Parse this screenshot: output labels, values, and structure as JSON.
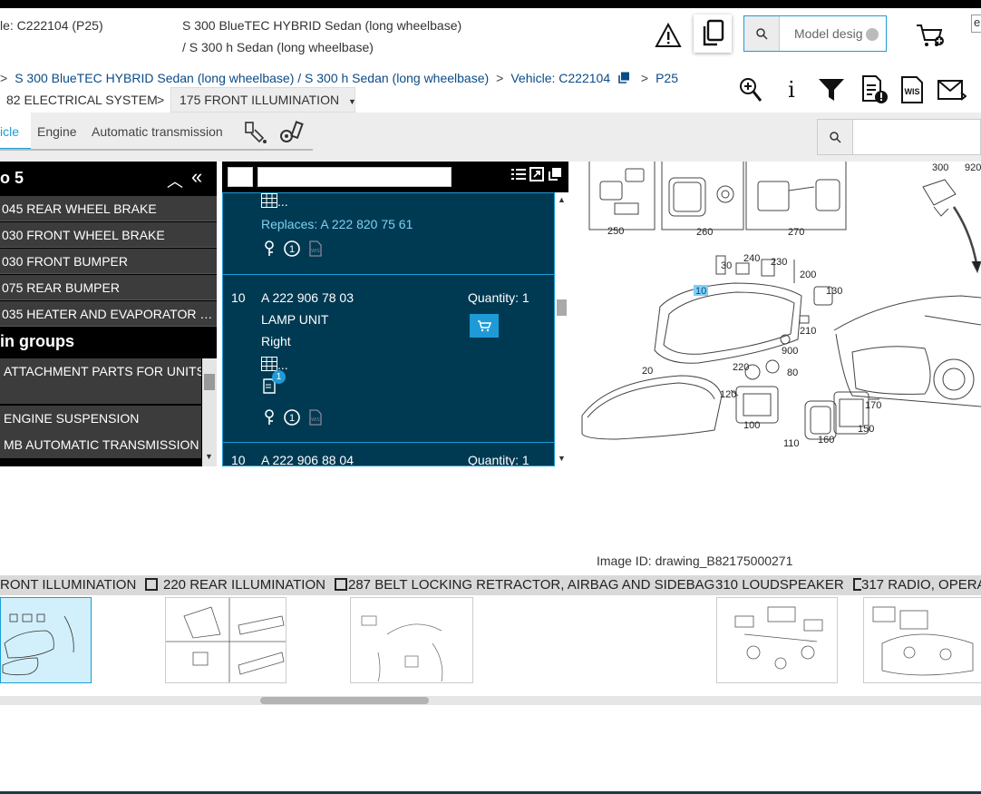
{
  "header": {
    "vehicle_prefix": "le: C222104 (P25)",
    "model_line1": "S 300 BlueTEC HYBRID Sedan (long wheelbase)",
    "model_line2": "/ S 300 h Sedan (long wheelbase)",
    "search_placeholder": "Model desig",
    "partial_right": "e"
  },
  "breadcrumb": {
    "item1": "S 300 BlueTEC HYBRID Sedan (long wheelbase) / S 300 h Sedan (long wheelbase)",
    "item2": "Vehicle: C222104",
    "item3": "P25",
    "group": "82 ELECTRICAL SYSTEM",
    "subgroup": "175 FRONT ILLUMINATION"
  },
  "tabs": [
    {
      "label": "icle"
    },
    {
      "label": "Engine"
    },
    {
      "label": "Automatic transmission"
    }
  ],
  "left_panel": {
    "title": "o 5",
    "recent": [
      "045 REAR WHEEL BRAKE",
      "030 FRONT WHEEL BRAKE",
      "030 FRONT BUMPER",
      "075 REAR BUMPER",
      "035 HEATER AND EVAPORATOR H..."
    ],
    "groups_title": "in groups",
    "groups": [
      "ATTACHMENT PARTS FOR UNITS",
      "ENGINE SUSPENSION",
      "MB AUTOMATIC TRANSMISSION"
    ]
  },
  "parts": {
    "first_replaces": "Replaces: A 222 820 75 61",
    "item1": {
      "pos": "10",
      "number": "A 222 906 78 03",
      "name": "LAMP UNIT",
      "side": "Right",
      "quantity": "Quantity: 1",
      "badge": "1"
    },
    "item2": {
      "pos": "10",
      "number": "A 222 906 88 04",
      "quantity": "Quantity: 1"
    },
    "table_more": "..."
  },
  "drawing": {
    "image_id": "Image ID: drawing_B82175000271",
    "labels": [
      "920",
      "300",
      "250",
      "260",
      "270",
      "30",
      "240",
      "230",
      "200",
      "10",
      "130",
      "210",
      "900",
      "220",
      "80",
      "120",
      "100",
      "20",
      "170",
      "150",
      "110",
      "160"
    ],
    "highlight": "10"
  },
  "thumbnails": [
    {
      "label": "RONT ILLUMINATION"
    },
    {
      "label": "220 REAR ILLUMINATION"
    },
    {
      "label": "287 BELT LOCKING RETRACTOR, AIRBAG AND SIDEBAG"
    },
    {
      "label": "310 LOUDSPEAKER"
    },
    {
      "label": "317 RADIO, OPERAT"
    }
  ],
  "colors": {
    "accent": "#1e9bd7",
    "panel_dark": "#003a52",
    "menu_gray": "#3c3c3c"
  }
}
